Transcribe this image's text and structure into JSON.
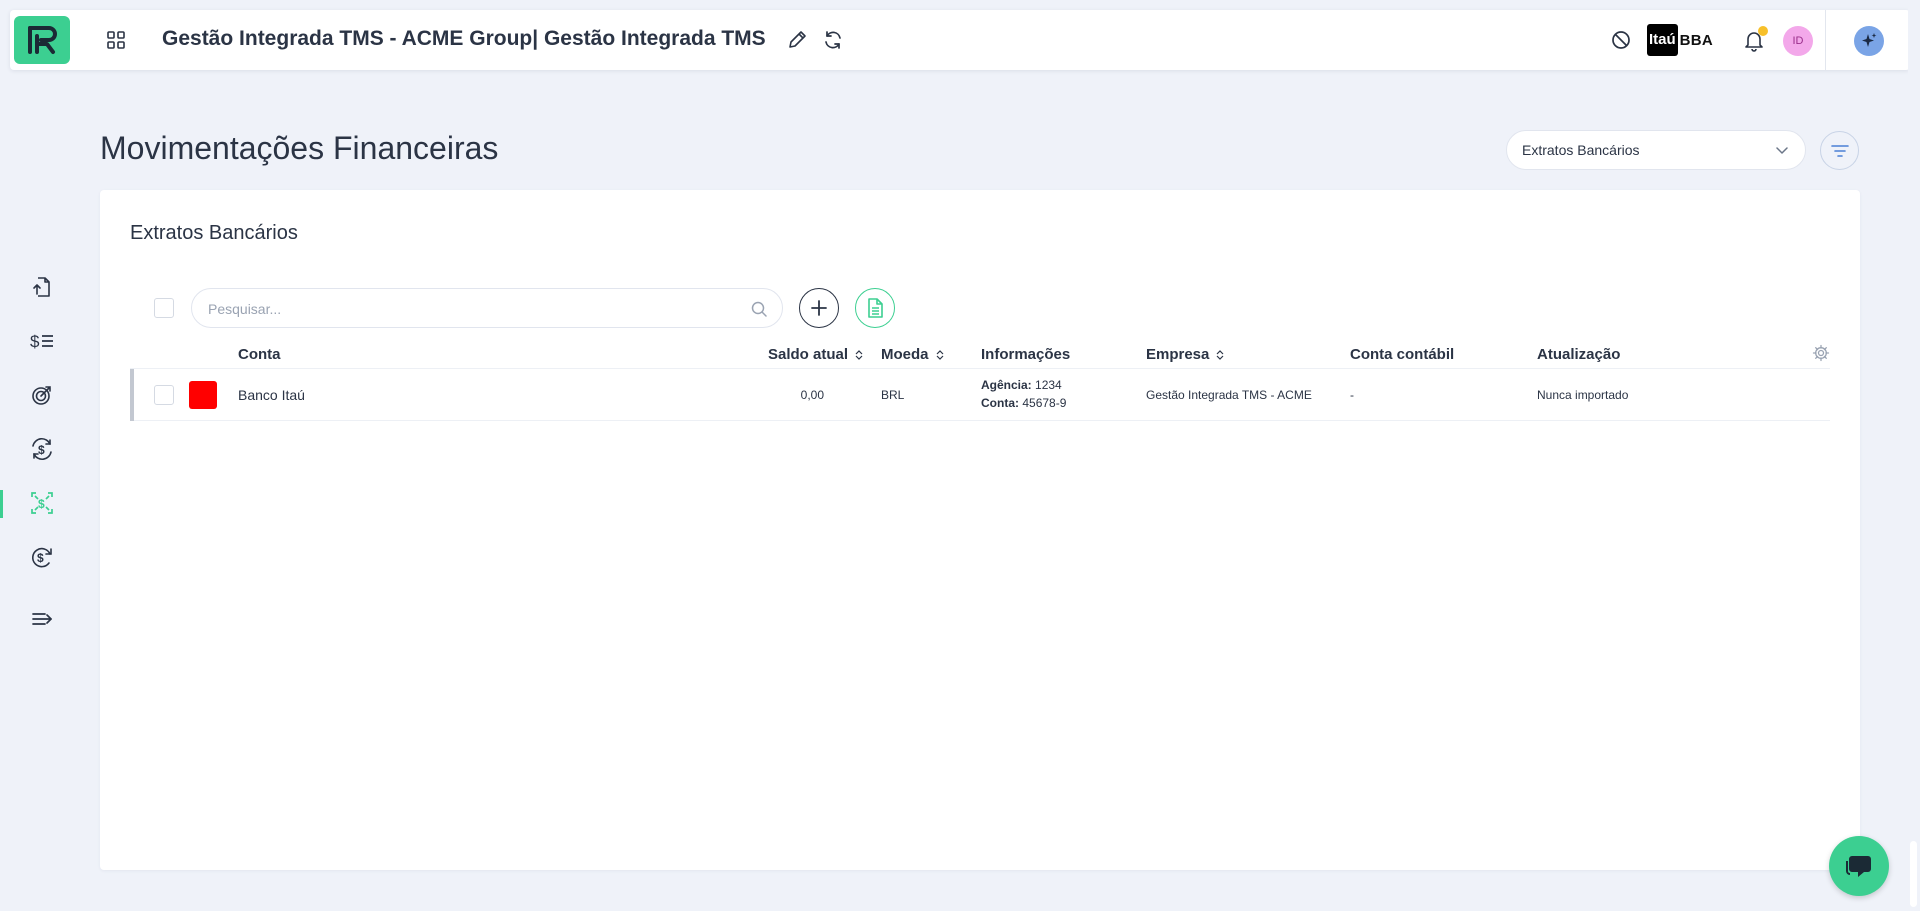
{
  "header": {
    "title": "Gestão Integrada TMS - ACME Group| Gestão Integrada TMS",
    "bank_name": "Itaú",
    "bank_suffix": "BBA",
    "avatar_initials": "ID"
  },
  "sidebar": {
    "items": [
      {
        "icon": "file-upload-icon"
      },
      {
        "icon": "dollar-list-icon"
      },
      {
        "icon": "target-arrow-icon"
      },
      {
        "icon": "exchange-dollar-icon"
      },
      {
        "icon": "transfer-dollar-icon",
        "active": true
      },
      {
        "icon": "dollar-refresh-icon"
      },
      {
        "icon": "expand-menu-icon"
      }
    ]
  },
  "page": {
    "title": "Movimentações Financeiras",
    "view_select": "Extratos Bancários"
  },
  "card": {
    "title": "Extratos Bancários",
    "search_placeholder": "Pesquisar...",
    "columns": {
      "conta": "Conta",
      "saldo": "Saldo atual",
      "moeda": "Moeda",
      "info": "Informações",
      "empresa": "Empresa",
      "conta_contabil": "Conta contábil",
      "atualizacao": "Atualização"
    },
    "rows": [
      {
        "color": "#ff0000",
        "conta": "Banco Itaú",
        "saldo": "0,00",
        "moeda": "BRL",
        "agencia_label": "Agência:",
        "agencia": "1234",
        "conta_label": "Conta:",
        "conta_num": "45678-9",
        "empresa": "Gestão Integrada TMS - ACME",
        "conta_contabil": "-",
        "atualizacao": "Nunca importado"
      }
    ]
  },
  "colors": {
    "brand": "#3ccf91",
    "background": "#eff2f9",
    "text": "#2b3445"
  }
}
